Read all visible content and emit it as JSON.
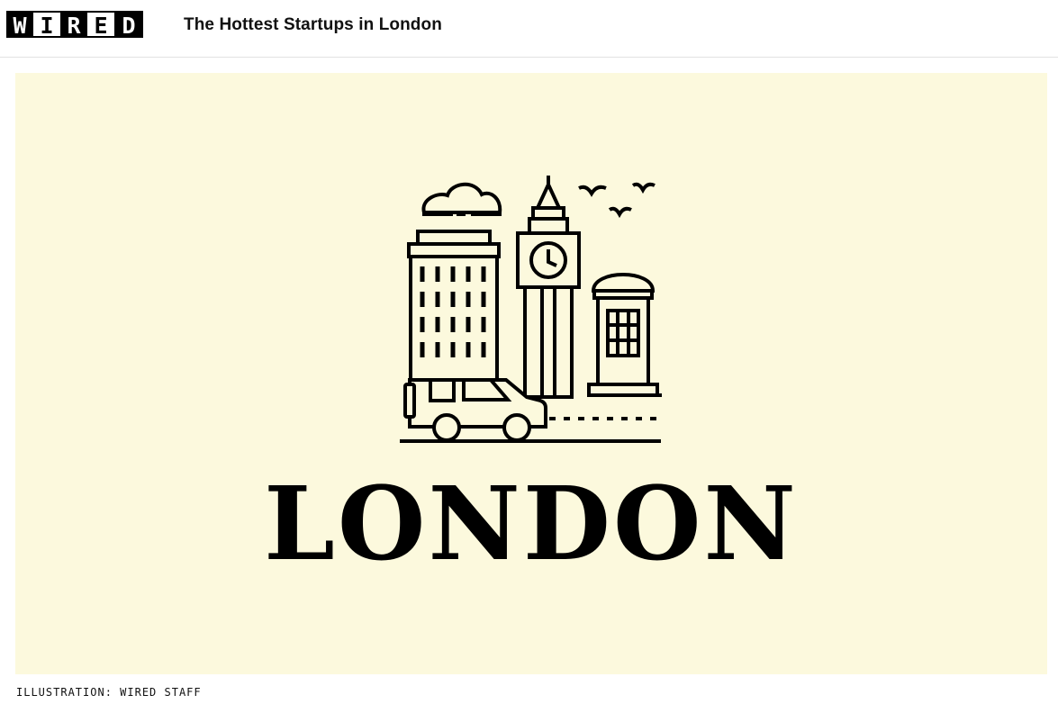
{
  "header": {
    "logo_letters": [
      "W",
      "I",
      "R",
      "E",
      "D"
    ],
    "article_title": "The Hottest Startups in London"
  },
  "hero": {
    "city_word": "LONDON",
    "background_color": "#fcf9dd",
    "illustration_icons": [
      "cloud-icon",
      "office-building-icon",
      "big-ben-icon",
      "clock-icon",
      "phone-box-icon",
      "taxi-icon",
      "birds-icon",
      "road-icon"
    ]
  },
  "caption": {
    "credit": "ILLUSTRATION: WIRED STAFF"
  }
}
